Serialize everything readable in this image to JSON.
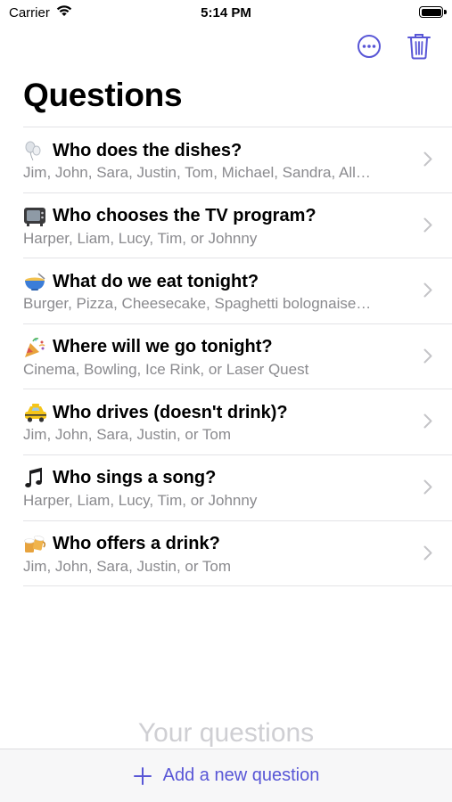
{
  "status_bar": {
    "carrier": "Carrier",
    "time": "5:14 PM",
    "battery_level": 1.0
  },
  "nav": {
    "more_icon": "ellipsis-circle-icon",
    "trash_icon": "trash-icon"
  },
  "page": {
    "title": "Questions"
  },
  "questions": [
    {
      "icon": "balloons-icon",
      "title": "Who does the dishes?",
      "subtitle": "Jim, John, Sara, Justin, Tom, Michael, Sandra, All…"
    },
    {
      "icon": "television-icon",
      "title": "Who chooses the TV program?",
      "subtitle": "Harper, Liam, Lucy, Tim, or Johnny"
    },
    {
      "icon": "bowl-icon",
      "title": "What do we eat tonight?",
      "subtitle": "Burger, Pizza, Cheesecake, Spaghetti bolognaise…"
    },
    {
      "icon": "party-popper-icon",
      "title": "Where will we go tonight?",
      "subtitle": "Cinema, Bowling, Ice Rink, or Laser Quest"
    },
    {
      "icon": "taxi-icon",
      "title": "Who drives (doesn't drink)?",
      "subtitle": "Jim, John, Sara, Justin, or Tom"
    },
    {
      "icon": "music-notes-icon",
      "title": "Who sings a song?",
      "subtitle": "Harper, Liam, Lucy, Tim, or Johnny"
    },
    {
      "icon": "beer-mugs-icon",
      "title": "Who offers a drink?",
      "subtitle": "Jim, John, Sara, Justin, or Tom"
    }
  ],
  "footer": {
    "section_label": "Your questions",
    "add_label": "Add a new question"
  },
  "colors": {
    "accent": "#5856d6",
    "secondary_text": "#8a8a8e",
    "separator": "#e3e3e6"
  }
}
